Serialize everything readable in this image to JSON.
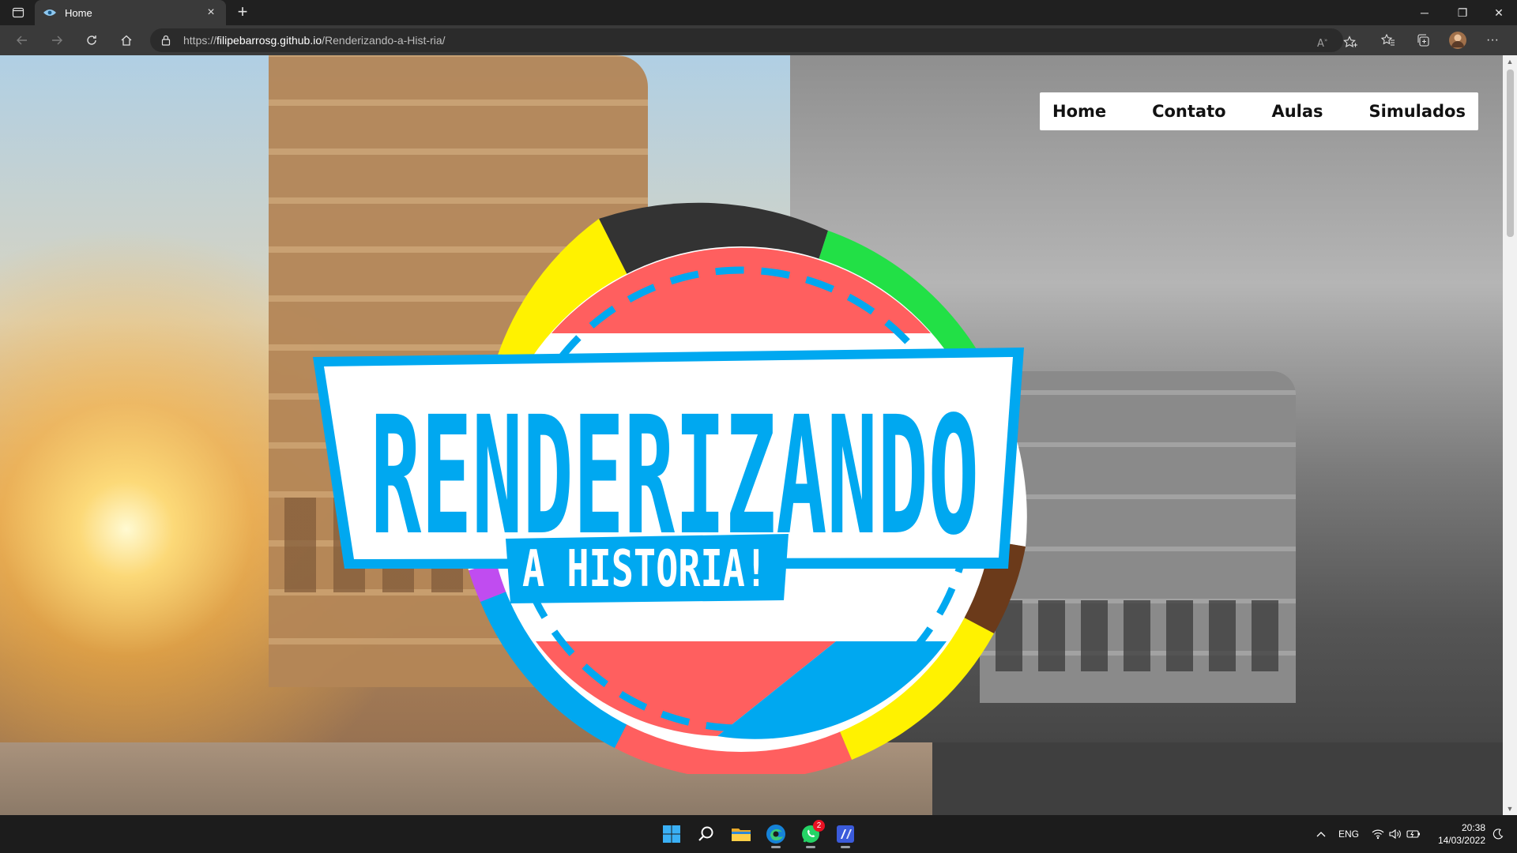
{
  "browser": {
    "tab": {
      "title": "Home",
      "favicon": "site-logo-icon"
    },
    "new_tab_label": "+",
    "window_controls": {
      "minimize": "─",
      "restore": "❐",
      "close": "✕"
    },
    "url_scheme": "https://",
    "url_host": "filipebarrosg.github.io",
    "url_path": "/Renderizando-a-Hist-ria/"
  },
  "site": {
    "nav": {
      "home": "Home",
      "contact": "Contato",
      "classes": "Aulas",
      "mock_exams": "Simulados"
    },
    "logo": {
      "main_text": "RENDERIZANDO",
      "sub_text": "A HISTORIA!"
    },
    "colors": {
      "logo_blue": "#00a8f0",
      "logo_red": "#ff5f5f",
      "ring_yellow": "#fff200",
      "ring_green": "#22e046",
      "ring_dark": "#333333",
      "ring_purple": "#c04cf0",
      "ring_brown": "#6b3a1a"
    }
  },
  "taskbar": {
    "apps": [
      "windows-start-icon",
      "search-icon",
      "file-explorer-icon",
      "edge-icon",
      "whatsapp-icon",
      "code-editor-icon"
    ],
    "whatsapp_badge": "2",
    "language": "ENG",
    "time": "20:38",
    "date": "14/03/2022"
  }
}
